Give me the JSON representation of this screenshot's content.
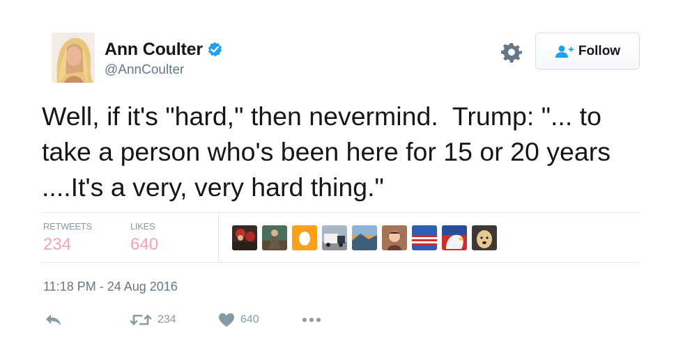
{
  "user": {
    "display_name": "Ann Coulter",
    "handle": "@AnnCoulter",
    "verified": true
  },
  "header": {
    "settings_icon": "gear-icon",
    "follow_label": "Follow",
    "follow_icon": "add-user-icon"
  },
  "tweet": {
    "text": "Well, if it's \"hard,\" then nevermind.  Trump: \"... to take a person who's been here for 15 or 20 years ....It's a very, very hard thing.\""
  },
  "stats": {
    "retweets_label": "RETWEETS",
    "retweets_value": "234",
    "likes_label": "LIKES",
    "likes_value": "640"
  },
  "likers": [
    {
      "name": "liker-avatar-1"
    },
    {
      "name": "liker-avatar-2"
    },
    {
      "name": "liker-avatar-3"
    },
    {
      "name": "liker-avatar-4"
    },
    {
      "name": "liker-avatar-5"
    },
    {
      "name": "liker-avatar-6"
    },
    {
      "name": "liker-avatar-7"
    },
    {
      "name": "liker-avatar-8"
    },
    {
      "name": "liker-avatar-9"
    }
  ],
  "timestamp": "11:18 PM - 24 Aug 2016",
  "actions": {
    "reply_icon": "reply-icon",
    "retweet_count": "234",
    "like_count": "640",
    "more_icon": "more-icon"
  },
  "colors": {
    "text": "#14171a",
    "secondary": "#657786",
    "muted": "#8899a6",
    "stat_value": "#f4a3b4",
    "verified": "#1da1f2",
    "follow_icon": "#1da1f2"
  }
}
